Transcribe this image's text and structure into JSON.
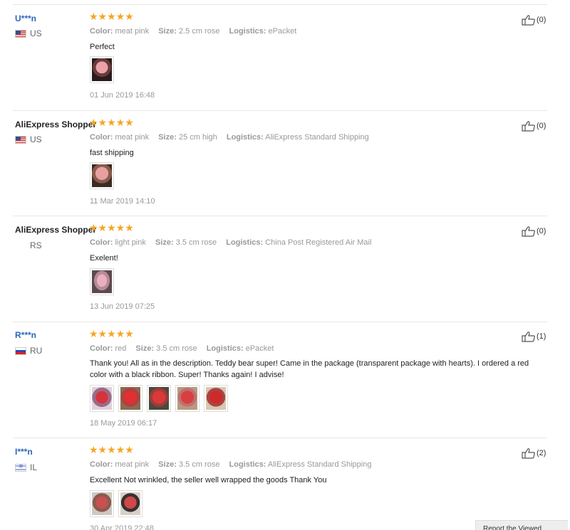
{
  "reviews": [
    {
      "user": "U***n",
      "masked": true,
      "country": "US",
      "flag": "us",
      "color_label": "Color:",
      "color": "meat pink",
      "size_label": "Size:",
      "size": "2.5 cm rose",
      "logistics_label": "Logistics:",
      "logistics": "ePacket",
      "text": "Perfect",
      "photos": [
        "photo-pink-rose"
      ],
      "date": "01 Jun 2019 16:48",
      "helpful": "(0)"
    },
    {
      "user": "AliExpress Shopper",
      "masked": false,
      "country": "US",
      "flag": "us",
      "color_label": "Color:",
      "color": "meat pink",
      "size_label": "Size:",
      "size": "25 cm high",
      "logistics_label": "Logistics:",
      "logistics": "AliExpress Standard Shipping",
      "text": "fast shipping",
      "photos": [
        "photo-pink-bear"
      ],
      "date": "11 Mar 2019 14:10",
      "helpful": "(0)"
    },
    {
      "user": "AliExpress Shopper",
      "masked": false,
      "country": "RS",
      "flag": "none",
      "color_label": "Color:",
      "color": "light pink",
      "size_label": "Size:",
      "size": "3.5 cm rose",
      "logistics_label": "Logistics:",
      "logistics": "China Post Registered Air Mail",
      "text": "Exelent!",
      "photos": [
        "photo-light-pink-bear"
      ],
      "date": "13 Jun 2019 07:25",
      "helpful": "(0)"
    },
    {
      "user": "R***n",
      "masked": true,
      "country": "RU",
      "flag": "ru",
      "color_label": "Color:",
      "color": "red",
      "size_label": "Size:",
      "size": "3.5 cm rose",
      "logistics_label": "Logistics:",
      "logistics": "ePacket",
      "text": "Thank you! All as in the description. Teddy bear super! Came in the package (transparent package with hearts). I ordered a red color with a black ribbon. Super! Thanks again! I advise!",
      "photos": [
        "photo-red-bear-1",
        "photo-red-bear-2",
        "photo-red-bear-3",
        "photo-red-bear-4",
        "photo-red-bear-5"
      ],
      "date": "18 May 2019 06:17",
      "helpful": "(1)"
    },
    {
      "user": "I***n",
      "masked": true,
      "country": "IL",
      "flag": "il",
      "color_label": "Color:",
      "color": "meat pink",
      "size_label": "Size:",
      "size": "3.5 cm rose",
      "logistics_label": "Logistics:",
      "logistics": "AliExpress Standard Shipping",
      "text": "Excellent Not wrinkled, the seller well wrapped the goods Thank You",
      "photos": [
        "photo-rose-bear-1",
        "photo-rose-bear-2"
      ],
      "date": "30 Apr 2019 22:48",
      "helpful": "(2)"
    }
  ],
  "stars": "★★★★★",
  "report_button": "Report the Viewed",
  "colors": {
    "star": "#f5a623",
    "link": "#2a67b8",
    "muted": "#999999"
  }
}
